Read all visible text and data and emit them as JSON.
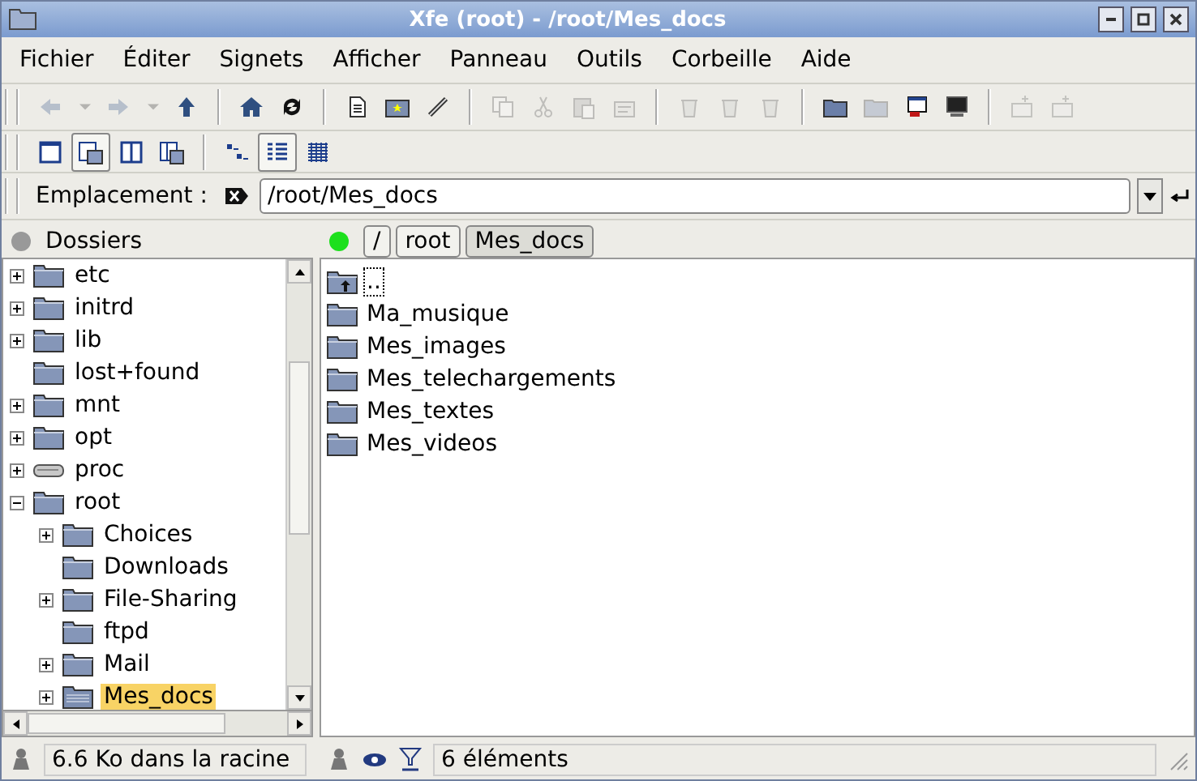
{
  "window": {
    "title": "Xfe (root) - /root/Mes_docs"
  },
  "menu": [
    {
      "label": "Fichier"
    },
    {
      "label": "Éditer"
    },
    {
      "label": "Signets"
    },
    {
      "label": "Afficher"
    },
    {
      "label": "Panneau"
    },
    {
      "label": "Outils"
    },
    {
      "label": "Corbeille"
    },
    {
      "label": "Aide"
    }
  ],
  "main_toolbar": [
    {
      "items": [
        {
          "kind": "back",
          "disabled": true
        },
        {
          "kind": "dropdown",
          "disabled": true
        },
        {
          "kind": "forward",
          "disabled": true
        },
        {
          "kind": "dropdown",
          "disabled": true
        },
        {
          "kind": "up",
          "disabled": false
        }
      ]
    },
    {
      "items": [
        {
          "kind": "home",
          "disabled": false
        },
        {
          "kind": "refresh",
          "disabled": false
        }
      ]
    },
    {
      "items": [
        {
          "kind": "newfile",
          "disabled": false
        },
        {
          "kind": "newfolder",
          "disabled": false
        },
        {
          "kind": "wand",
          "disabled": false
        }
      ]
    },
    {
      "items": [
        {
          "kind": "copy",
          "disabled": true
        },
        {
          "kind": "cut",
          "disabled": true
        },
        {
          "kind": "paste",
          "disabled": true
        },
        {
          "kind": "props",
          "disabled": true
        }
      ]
    },
    {
      "items": [
        {
          "kind": "bin",
          "disabled": true
        },
        {
          "kind": "bin",
          "disabled": true
        },
        {
          "kind": "bin",
          "disabled": true
        }
      ]
    },
    {
      "items": [
        {
          "kind": "folder",
          "disabled": false
        },
        {
          "kind": "folder",
          "disabled": true
        },
        {
          "kind": "runner",
          "disabled": false
        },
        {
          "kind": "terminal",
          "disabled": false
        }
      ]
    },
    {
      "items": [
        {
          "kind": "tabnew",
          "disabled": true
        },
        {
          "kind": "tabdel",
          "disabled": true
        }
      ]
    }
  ],
  "view_toolbar": [
    {
      "items": [
        {
          "kind": "onepanel",
          "selected": false
        },
        {
          "kind": "treepanel",
          "selected": true
        },
        {
          "kind": "twopanels",
          "selected": false
        },
        {
          "kind": "treetwo",
          "selected": false
        }
      ]
    },
    {
      "items": [
        {
          "kind": "smallicons",
          "selected": false
        },
        {
          "kind": "details",
          "selected": true
        },
        {
          "kind": "biglist",
          "selected": false
        }
      ]
    }
  ],
  "location": {
    "label": "Emplacement :",
    "value": "/root/Mes_docs"
  },
  "folders_panel": {
    "title": "Dossiers",
    "active": false,
    "tree": [
      {
        "name": "etc",
        "kind": "folder",
        "expanded": false,
        "selected": false
      },
      {
        "name": "initrd",
        "kind": "folder",
        "expanded": false,
        "selected": false
      },
      {
        "name": "lib",
        "kind": "folder",
        "expanded": false,
        "selected": false
      },
      {
        "name": "lost+found",
        "kind": "folder",
        "selected": false
      },
      {
        "name": "mnt",
        "kind": "folder",
        "expanded": false,
        "selected": false
      },
      {
        "name": "opt",
        "kind": "folder",
        "expanded": false,
        "selected": false
      },
      {
        "name": "proc",
        "kind": "drive",
        "expanded": false,
        "selected": false
      },
      {
        "name": "root",
        "kind": "folder",
        "expanded": true,
        "selected": false,
        "children": [
          {
            "name": "Choices",
            "kind": "folder",
            "expanded": false,
            "selected": false
          },
          {
            "name": "Downloads",
            "kind": "folder",
            "selected": false
          },
          {
            "name": "File-Sharing",
            "kind": "folder",
            "expanded": false,
            "selected": false
          },
          {
            "name": "ftpd",
            "kind": "folder",
            "selected": false
          },
          {
            "name": "Mail",
            "kind": "folder",
            "expanded": false,
            "selected": false
          },
          {
            "name": "Mes_docs",
            "kind": "openfolder",
            "expanded": false,
            "selected": true
          }
        ]
      }
    ],
    "status": "6.6 Ko dans la racine"
  },
  "files_panel": {
    "active": true,
    "breadcrumb": [
      {
        "label": "/",
        "selected": false
      },
      {
        "label": "root",
        "selected": false
      },
      {
        "label": "Mes_docs",
        "selected": true
      }
    ],
    "files": [
      {
        "name": "..",
        "kind": "parent",
        "focused": true
      },
      {
        "name": "Ma_musique",
        "kind": "folder",
        "focused": false
      },
      {
        "name": "Mes_images",
        "kind": "folder",
        "focused": false
      },
      {
        "name": "Mes_telechargements",
        "kind": "folder",
        "focused": false
      },
      {
        "name": "Mes_textes",
        "kind": "folder",
        "focused": false
      },
      {
        "name": "Mes_videos",
        "kind": "folder",
        "focused": false
      }
    ],
    "status": "6 éléments"
  }
}
